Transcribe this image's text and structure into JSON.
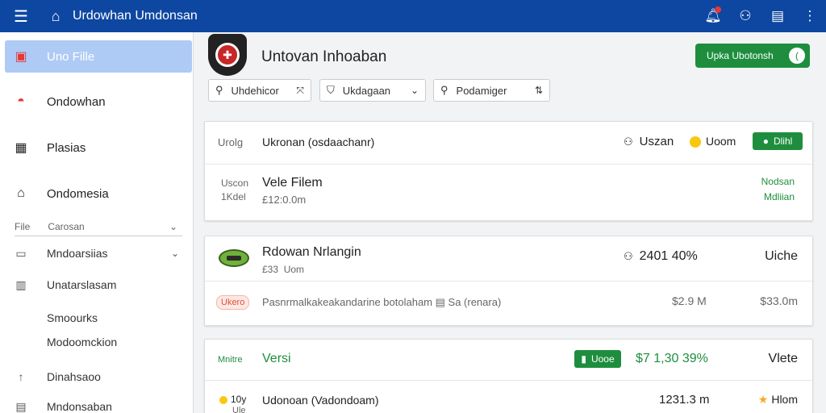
{
  "topbar": {
    "title": "Urdowhan Umdonsan",
    "icons": [
      "menu-icon",
      "home-icon",
      "notification-icon",
      "user-icon",
      "clipboard-icon",
      "more-vert-icon"
    ]
  },
  "sidebar": {
    "items": [
      {
        "label": "Uno Fille",
        "icon": "file-icon"
      },
      {
        "label": "Ondowhan",
        "icon": "flag-circle-icon"
      },
      {
        "label": "Plasias",
        "icon": "calendar-icon"
      },
      {
        "label": "Ondomesia",
        "icon": "inbox-icon"
      }
    ],
    "section": {
      "label_1": "File",
      "label_2": "Carosan"
    },
    "sub_items": [
      {
        "label": "Mndoarsiias",
        "icon": "image-icon"
      },
      {
        "label": "Unatarslasam",
        "icon": "calendar-day-icon"
      },
      {
        "label": "Smoourks",
        "icon": ""
      },
      {
        "label": "Modoomckion",
        "icon": ""
      },
      {
        "label": "Dinahsaoo",
        "icon": "arrow-up-icon"
      },
      {
        "label": "Mndonsaban",
        "icon": "list-icon"
      }
    ]
  },
  "header": {
    "title": "Untovan Inhoaban",
    "primary_button": "Upka Ubotonsh",
    "primary_button_glyph": "(",
    "filters": [
      {
        "label": "Uhdehicor",
        "icon": "search-icon",
        "end": "⤧"
      },
      {
        "label": "Ukdagaan",
        "icon": "shield-icon",
        "end": "⌄"
      },
      {
        "label": "Podamiger",
        "icon": "search-icon",
        "end": "⇅"
      }
    ]
  },
  "cards": [
    {
      "header_left": "Urolg",
      "header_title": "Ukronan (osdaachanr)",
      "header_stat": "Uszan",
      "header_coin": "Uoom",
      "header_badge": "Dlihl",
      "row_label_1": "Uscon",
      "row_label_2": "1Kdel",
      "row_title": "Vele Filem",
      "row_sub": "£12:0.0m",
      "row_right_1": "Nodsan",
      "row_right_2": "Mdliian"
    },
    {
      "title": "Rdowan Nrlangin",
      "sub": "£33  Uom",
      "stat": "2401 40%",
      "right": "Uiche",
      "badge": "Ukero",
      "desc": "Pasnrmalkakeakandarine botolaham ▤ Sa (renara)",
      "val_1": "$2.9 M",
      "val_2": "$33.0m"
    },
    {
      "left": "Mnitre",
      "title": "Versi",
      "badge": "Uooe",
      "stat": "$7 1,30 39%",
      "right": "Vlete",
      "row_left_1": "10y",
      "row_left_2": "Ule",
      "row_title": "Udonoan (Vadondoam)",
      "row_value": "1231.3 m",
      "row_right": "Hlom"
    }
  ],
  "colors": {
    "topbar": "#0d47a1",
    "accent_green": "#1e8e3e",
    "sidebar_active": "#aecbf5",
    "danger": "#e53935"
  }
}
